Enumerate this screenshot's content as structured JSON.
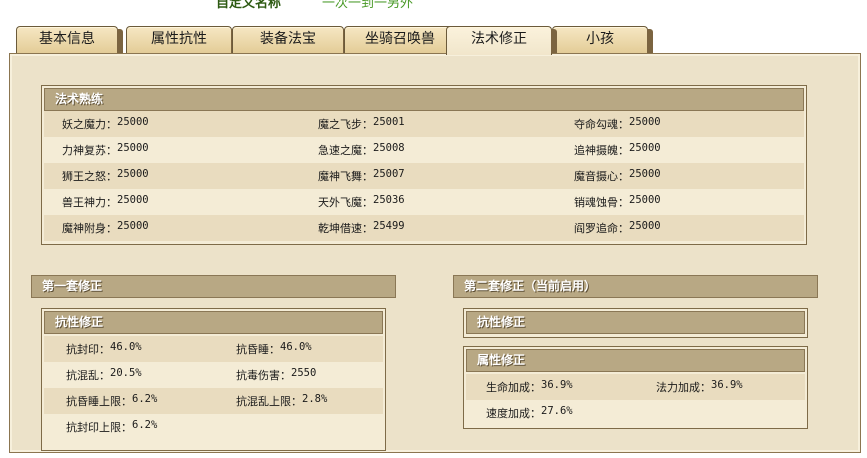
{
  "top": {
    "title": "自定义名称",
    "sub": "一次一到一另外"
  },
  "tabs": [
    {
      "label": "基本信息"
    },
    {
      "label": "属性抗性"
    },
    {
      "label": "装备法宝"
    },
    {
      "label": "坐骑召唤兽"
    },
    {
      "label": "法术修正",
      "active": true
    },
    {
      "label": "小孩"
    }
  ],
  "skill_panel": {
    "title": "法术熟练",
    "rows": [
      [
        {
          "k": "妖之魔力：",
          "v": "25000"
        },
        {
          "k": "魔之飞步：",
          "v": "25001"
        },
        {
          "k": "夺命勾魂：",
          "v": "25000"
        }
      ],
      [
        {
          "k": "力神复苏：",
          "v": "25000"
        },
        {
          "k": "急速之魔：",
          "v": "25008"
        },
        {
          "k": "追神摄魄：",
          "v": "25000"
        }
      ],
      [
        {
          "k": "狮王之怒：",
          "v": "25000"
        },
        {
          "k": "魔神飞舞：",
          "v": "25007"
        },
        {
          "k": "魔音摄心：",
          "v": "25000"
        }
      ],
      [
        {
          "k": "兽王神力：",
          "v": "25000"
        },
        {
          "k": "天外飞魔：",
          "v": "25036"
        },
        {
          "k": "销魂蚀骨：",
          "v": "25000"
        }
      ],
      [
        {
          "k": "魔神附身：",
          "v": "25000"
        },
        {
          "k": "乾坤借速：",
          "v": "25499"
        },
        {
          "k": "阎罗追命：",
          "v": "25000"
        }
      ]
    ]
  },
  "set1": {
    "title": "第一套修正",
    "resist": {
      "title": "抗性修正",
      "rows": [
        [
          {
            "k": "抗封印：",
            "v": "46.0%"
          },
          {
            "k": "抗昏睡：",
            "v": "46.0%"
          }
        ],
        [
          {
            "k": "抗混乱：",
            "v": "20.5%"
          },
          {
            "k": "抗毒伤害：",
            "v": "2550"
          }
        ],
        [
          {
            "k": "抗昏睡上限：",
            "v": "6.2%"
          },
          {
            "k": "抗混乱上限：",
            "v": "2.8%"
          }
        ],
        [
          {
            "k": "抗封印上限：",
            "v": "6.2%"
          }
        ]
      ]
    }
  },
  "set2": {
    "title": "第二套修正（当前启用）",
    "resist": {
      "title": "抗性修正"
    },
    "attr": {
      "title": "属性修正",
      "rows": [
        [
          {
            "k": "生命加成：",
            "v": "36.9%"
          },
          {
            "k": "法力加成：",
            "v": "36.9%"
          }
        ],
        [
          {
            "k": "速度加成：",
            "v": "27.6%"
          }
        ]
      ]
    }
  }
}
